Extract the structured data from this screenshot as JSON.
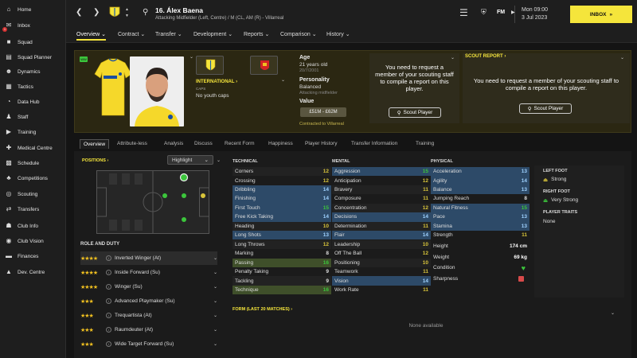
{
  "sidebar": {
    "items": [
      {
        "label": "Home",
        "icon": "home-icon"
      },
      {
        "label": "Inbox",
        "icon": "envelope-icon",
        "badge": "1"
      },
      {
        "label": "Squad",
        "icon": "shirt-icon"
      },
      {
        "label": "Squad Planner",
        "icon": "clipboard-icon"
      },
      {
        "label": "Dynamics",
        "icon": "people-icon"
      },
      {
        "label": "Tactics",
        "icon": "tactics-board-icon"
      },
      {
        "label": "Data Hub",
        "icon": "pie-chart-icon"
      },
      {
        "label": "Staff",
        "icon": "staff-icon"
      },
      {
        "label": "Training",
        "icon": "whistle-icon"
      },
      {
        "label": "Medical Centre",
        "icon": "medical-cross-icon"
      },
      {
        "label": "Schedule",
        "icon": "calendar-icon"
      },
      {
        "label": "Competitions",
        "icon": "trophy-icon"
      },
      {
        "label": "Scouting",
        "icon": "binoculars-icon"
      },
      {
        "label": "Transfers",
        "icon": "transfer-arrows-icon"
      },
      {
        "label": "Club Info",
        "icon": "club-info-icon"
      },
      {
        "label": "Club Vision",
        "icon": "eye-icon"
      },
      {
        "label": "Finances",
        "icon": "money-icon"
      },
      {
        "label": "Dev. Centre",
        "icon": "dev-centre-icon"
      }
    ]
  },
  "topbar": {
    "player_name": "16. Álex Baena",
    "player_desc": "Attacking Midfielder (Left, Centre) / M (CL, AM (R) - Villarreal",
    "day_time": "Mon 09:00",
    "date": "3 Jul 2023",
    "inbox_label": "INBOX",
    "fm_label": "FM"
  },
  "submenu": [
    "Overview",
    "Contract",
    "Transfer",
    "Development",
    "Reports",
    "Comparison",
    "History"
  ],
  "header": {
    "international_label": "INTERNATIONAL",
    "caps_label": "CAPS",
    "youth_caps": "No youth caps",
    "small_badge": "WW",
    "age_label": "Age",
    "age_value": "21 years old",
    "dob": "20/7/2001",
    "personality_label": "Personality",
    "personality_value": "Balanced",
    "role_text": "Attacking midfielder",
    "value_label": "Value",
    "value_range": "£51M - £62M",
    "contract_text": "Contracted to Villarreal",
    "request_text": "You need to request a member of your scouting staff to compile a report on this player.",
    "scout_button": "Scout Player",
    "scout_report_label": "SCOUT REPORT"
  },
  "tabs": [
    "Overview",
    "Attribute-less",
    "Analysis",
    "Discuss",
    "Recent Form",
    "Happiness",
    "Player History",
    "Transfer Information",
    "Training"
  ],
  "positions": {
    "label": "POSITIONS",
    "highlight_label": "Highlight"
  },
  "roles": {
    "title": "ROLE AND DUTY",
    "items": [
      {
        "stars": "★★★★",
        "name": "Inverted Winger (At)"
      },
      {
        "stars": "★★★★",
        "name": "Inside Forward (Su)"
      },
      {
        "stars": "★★★★",
        "name": "Winger (Su)"
      },
      {
        "stars": "★★★",
        "name": "Advanced Playmaker (Su)"
      },
      {
        "stars": "★★★",
        "name": "Trequartista (At)"
      },
      {
        "stars": "★★★",
        "name": "Raumdeuter (At)"
      },
      {
        "stars": "★★★",
        "name": "Wide Target Forward (Su)"
      }
    ]
  },
  "technical": {
    "title": "TECHNICAL",
    "rows": [
      {
        "name": "Corners",
        "value": "12"
      },
      {
        "name": "Crossing",
        "value": "12"
      },
      {
        "name": "Dribbling",
        "value": "14"
      },
      {
        "name": "Finishing",
        "value": "14"
      },
      {
        "name": "First Touch",
        "value": "15"
      },
      {
        "name": "Free Kick Taking",
        "value": "14"
      },
      {
        "name": "Heading",
        "value": "10"
      },
      {
        "name": "Long Shots",
        "value": "13"
      },
      {
        "name": "Long Throws",
        "value": "12"
      },
      {
        "name": "Marking",
        "value": "8"
      },
      {
        "name": "Passing",
        "value": "16"
      },
      {
        "name": "Penalty Taking",
        "value": "9"
      },
      {
        "name": "Tackling",
        "value": "9"
      },
      {
        "name": "Technique",
        "value": "16"
      }
    ]
  },
  "mental": {
    "title": "MENTAL",
    "rows": [
      {
        "name": "Aggression",
        "value": "15"
      },
      {
        "name": "Anticipation",
        "value": "12"
      },
      {
        "name": "Bravery",
        "value": "11"
      },
      {
        "name": "Composure",
        "value": "11"
      },
      {
        "name": "Concentration",
        "value": "12"
      },
      {
        "name": "Decisions",
        "value": "14"
      },
      {
        "name": "Determination",
        "value": "11"
      },
      {
        "name": "Flair",
        "value": "14"
      },
      {
        "name": "Leadership",
        "value": "10"
      },
      {
        "name": "Off The Ball",
        "value": "12"
      },
      {
        "name": "Positioning",
        "value": "10"
      },
      {
        "name": "Teamwork",
        "value": "11"
      },
      {
        "name": "Vision",
        "value": "14"
      },
      {
        "name": "Work Rate",
        "value": "11"
      }
    ]
  },
  "physical": {
    "title": "PHYSICAL",
    "rows": [
      {
        "name": "Acceleration",
        "value": "13"
      },
      {
        "name": "Agility",
        "value": "14"
      },
      {
        "name": "Balance",
        "value": "13"
      },
      {
        "name": "Jumping Reach",
        "value": "8"
      },
      {
        "name": "Natural Fitness",
        "value": "15"
      },
      {
        "name": "Pace",
        "value": "13"
      },
      {
        "name": "Stamina",
        "value": "13"
      },
      {
        "name": "Strength",
        "value": "11"
      }
    ]
  },
  "info": {
    "height_label": "Height",
    "height": "174 cm",
    "weight_label": "Weight",
    "weight": "69 kg",
    "condition_label": "Condition",
    "sharpness_label": "Sharpness"
  },
  "feet": {
    "left_label": "LEFT FOOT",
    "left_value": "Strong",
    "right_label": "RIGHT FOOT",
    "right_value": "Very Strong",
    "traits_label": "PLAYER TRAITS",
    "traits_value": "None"
  },
  "form": {
    "title": "FORM (LAST 20 MATCHES)",
    "empty": "None available"
  },
  "colors": {
    "accent": "#f5e53b",
    "highlight_row": "#2d4a68",
    "header_bg": "#2b2712",
    "green": "#3cc63c"
  }
}
